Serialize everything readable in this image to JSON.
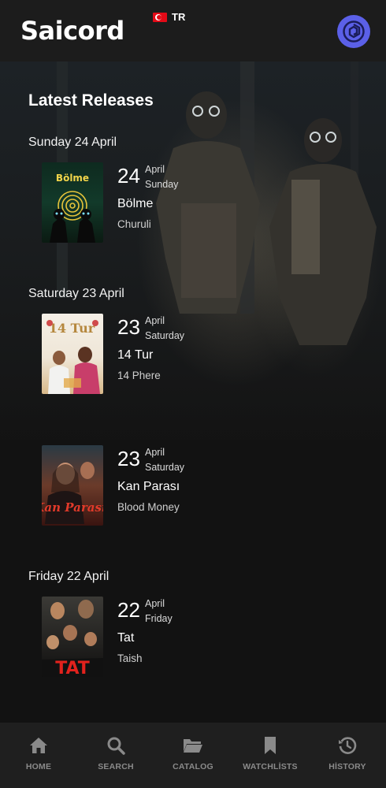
{
  "app": {
    "logo": "Saicord",
    "region_code": "TR"
  },
  "page": {
    "title": "Latest Releases"
  },
  "groups": [
    {
      "date_label": "Sunday 24 April",
      "releases": [
        {
          "day": "24",
          "month": "April",
          "weekday": "Sunday",
          "title": "Bölme",
          "subtitle": "Churuli",
          "poster_text": "Bölme"
        }
      ]
    },
    {
      "date_label": "Saturday 23 April",
      "releases": [
        {
          "day": "23",
          "month": "April",
          "weekday": "Saturday",
          "title": "14 Tur",
          "subtitle": "14 Phere",
          "poster_text": "14 Tur"
        },
        {
          "day": "23",
          "month": "April",
          "weekday": "Saturday",
          "title": "Kan Parası",
          "subtitle": "Blood Money",
          "poster_text": "Kan Parası"
        }
      ]
    },
    {
      "date_label": "Friday 22 April",
      "releases": [
        {
          "day": "22",
          "month": "April",
          "weekday": "Friday",
          "title": "Tat",
          "subtitle": "Taish",
          "poster_text": "TAT"
        }
      ]
    }
  ],
  "nav": {
    "items": [
      {
        "label": "HOME",
        "icon": "home-icon"
      },
      {
        "label": "SEARCH",
        "icon": "search-icon"
      },
      {
        "label": "CATALOG",
        "icon": "folder-icon"
      },
      {
        "label": "WATCHLİSTS",
        "icon": "bookmark-icon"
      },
      {
        "label": "HİSTORY",
        "icon": "history-icon"
      }
    ]
  },
  "colors": {
    "accent": "#5b60e8",
    "nav_inactive": "#8a8a8a",
    "background": "#121212"
  }
}
